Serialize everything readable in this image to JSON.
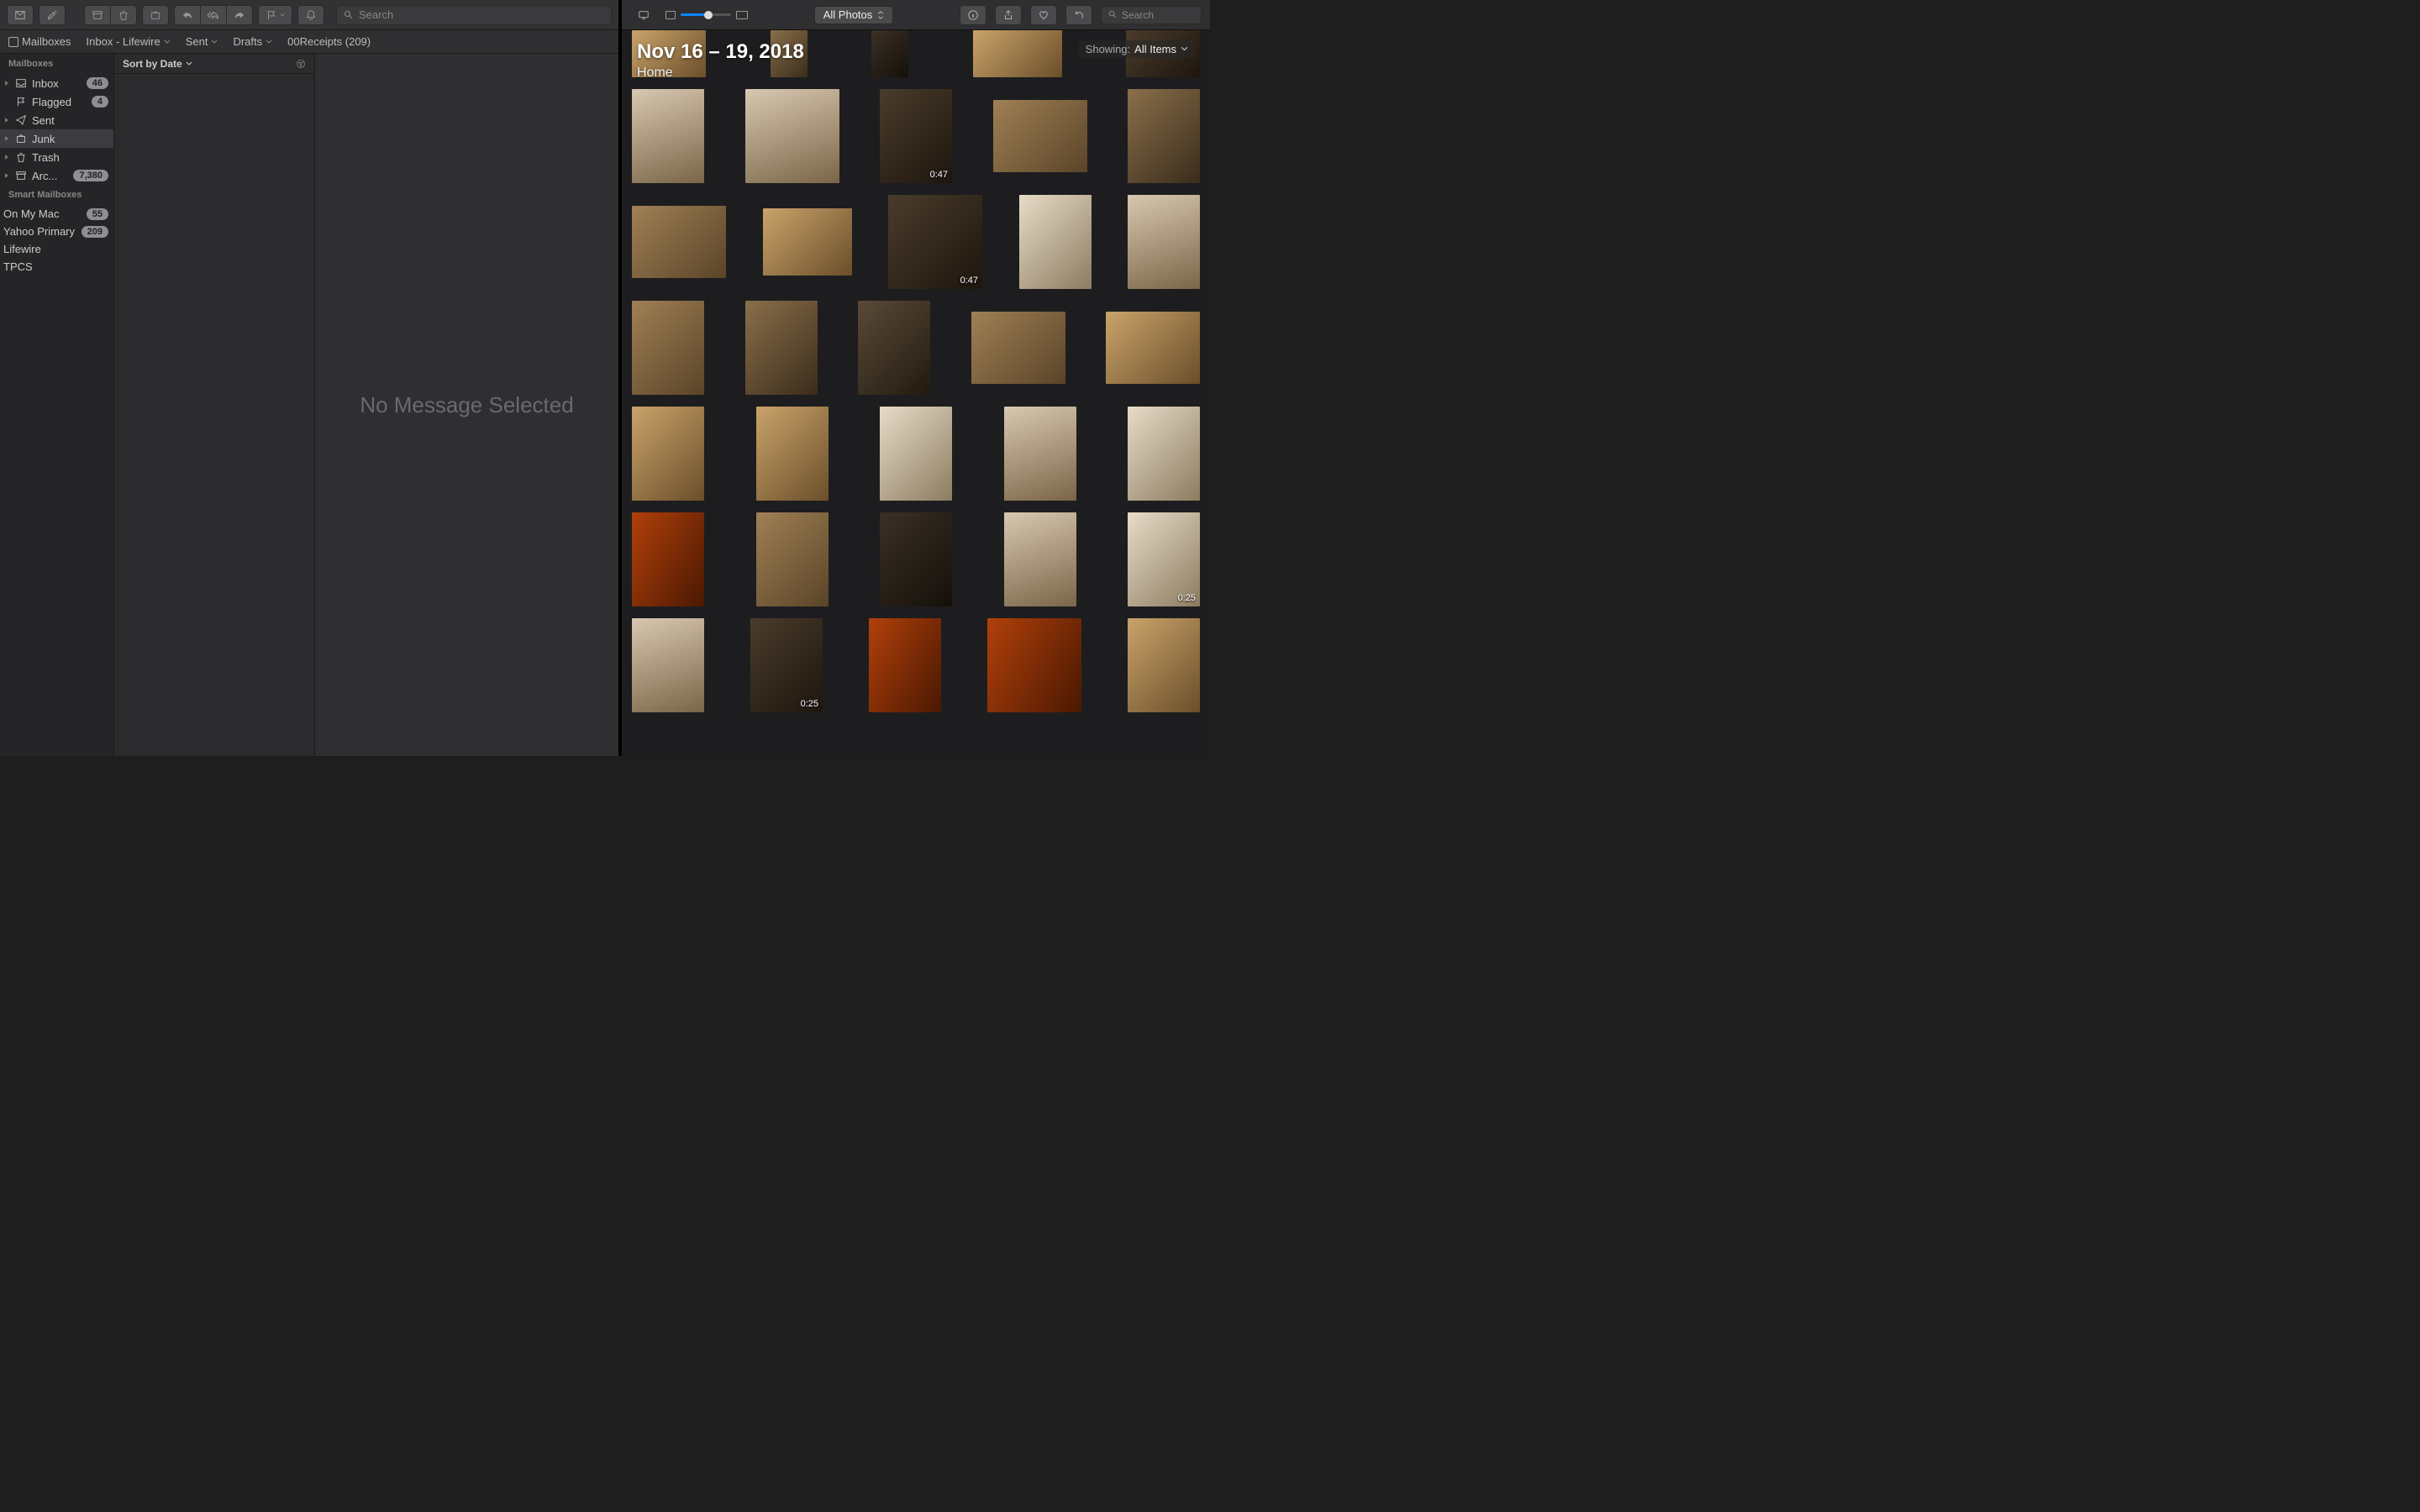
{
  "mail": {
    "search_placeholder": "Search",
    "favorites": {
      "mailboxes": "Mailboxes",
      "inbox_lifewire": "Inbox - Lifewire",
      "sent": "Sent",
      "drafts": "Drafts",
      "receipts": "00Receipts (209)"
    },
    "sidebar": {
      "section_mailboxes": "Mailboxes",
      "inbox": {
        "label": "Inbox",
        "badge": "46"
      },
      "flagged": {
        "label": "Flagged",
        "badge": "4"
      },
      "sent": {
        "label": "Sent"
      },
      "junk": {
        "label": "Junk"
      },
      "trash": {
        "label": "Trash"
      },
      "archive": {
        "label": "Arc...",
        "badge": "7,380"
      },
      "section_smart": "Smart Mailboxes",
      "on_my_mac": {
        "label": "On My Mac",
        "badge": "55"
      },
      "yahoo_primary": {
        "label": "Yahoo Primary",
        "badge": "209"
      },
      "lifewire": {
        "label": "Lifewire"
      },
      "tpcs": {
        "label": "TPCS"
      }
    },
    "msglist": {
      "sort_label": "Sort by Date"
    },
    "empty_view": "No Message Selected"
  },
  "photos": {
    "search_placeholder": "Search",
    "filter_label": "All Photos",
    "title": "Nov 16 – 19, 2018",
    "subtitle": "Home",
    "showing_label": "Showing:",
    "showing_value": "All Items",
    "durations": {
      "d1": "0:47",
      "d2": "0:47",
      "d3": "0:25",
      "d4": "0:25"
    }
  }
}
